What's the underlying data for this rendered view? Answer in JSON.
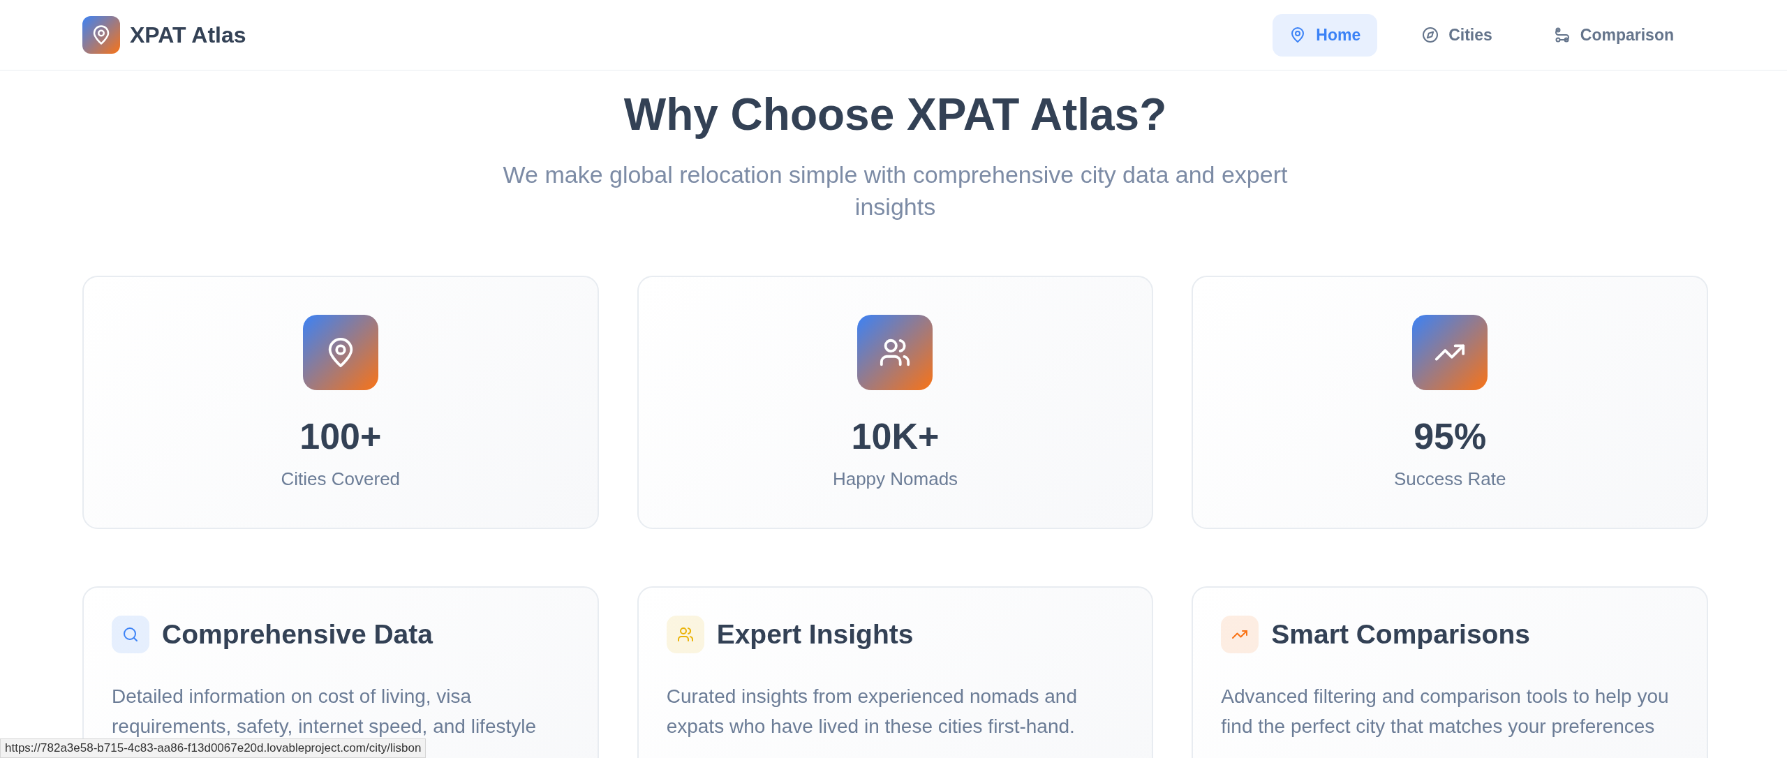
{
  "brand": {
    "name": "XPAT Atlas"
  },
  "nav": [
    {
      "label": "Home",
      "kind": "pin",
      "selected": true
    },
    {
      "label": "Cities",
      "kind": "compass",
      "selected": false
    },
    {
      "label": "Comparison",
      "kind": "route",
      "selected": false
    }
  ],
  "hero": {
    "title": "Why Choose XPAT Atlas?",
    "subtitle": "We make global relocation simple with comprehensive city data and expert insights"
  },
  "stats": [
    {
      "kind": "pin",
      "value": "100+",
      "label": "Cities Covered"
    },
    {
      "kind": "users",
      "value": "10K+",
      "label": "Happy Nomads"
    },
    {
      "kind": "trend",
      "value": "95%",
      "label": "Success Rate"
    }
  ],
  "features": [
    {
      "kind": "search",
      "color": "#3b82f6",
      "title": "Comprehensive Data",
      "description": "Detailed information on cost of living, visa requirements, safety, internet speed, and lifestyle"
    },
    {
      "kind": "users",
      "color": "#eab308",
      "title": "Expert Insights",
      "description": "Curated insights from experienced nomads and expats who have lived in these cities first-hand."
    },
    {
      "kind": "trend",
      "color": "#f97316",
      "title": "Smart Comparisons",
      "description": "Advanced filtering and comparison tools to help you find the perfect city that matches your preferences"
    }
  ],
  "status_bar": {
    "url": "https://782a3e58-b715-4c83-aa86-f13d0067e20d.lovableproject.com/city/lisbon"
  }
}
